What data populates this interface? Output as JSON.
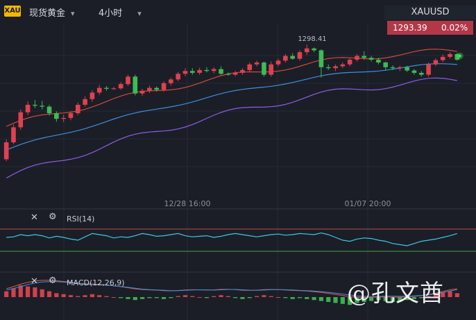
{
  "header": {
    "logo_text": "XAU",
    "symbol_label": "现货黄金",
    "timeframe_label": "4小时",
    "chevron_icon": "chevron-down-icon"
  },
  "quote": {
    "symbol": "XAUUSD",
    "price": "1293.39",
    "change": "0.02%"
  },
  "indicators": {
    "rsi_label": "RSI(14)",
    "macd_label": "MACD(12,26,9)",
    "close_icon": "close-icon",
    "settings_icon": "gear-icon"
  },
  "watermark": "@孔文酋",
  "chart_data": {
    "type": "candlestick",
    "symbol": "XAUUSD",
    "timeframe": "4h",
    "x_tick_labels": [
      "12/28 16:00",
      "01/07 20:00"
    ],
    "price_annotations": {
      "high": "1298.41",
      "last": "1293.39"
    },
    "ohlc": [
      [
        1274.0,
        1278.2,
        1273.6,
        1277.6
      ],
      [
        1277.6,
        1281.4,
        1277.2,
        1280.8
      ],
      [
        1280.8,
        1284.6,
        1280.3,
        1284.0
      ],
      [
        1284.0,
        1286.3,
        1283.4,
        1285.6
      ],
      [
        1285.6,
        1286.6,
        1284.9,
        1285.4
      ],
      [
        1285.4,
        1286.4,
        1284.6,
        1285.2
      ],
      [
        1285.2,
        1285.6,
        1283.3,
        1283.8
      ],
      [
        1283.8,
        1284.2,
        1282.0,
        1282.6
      ],
      [
        1282.6,
        1283.5,
        1281.9,
        1282.8
      ],
      [
        1282.8,
        1284.2,
        1282.3,
        1283.8
      ],
      [
        1283.8,
        1286.1,
        1283.4,
        1285.6
      ],
      [
        1285.6,
        1287.4,
        1285.2,
        1286.8
      ],
      [
        1286.8,
        1288.7,
        1286.2,
        1288.2
      ],
      [
        1288.2,
        1289.8,
        1287.7,
        1289.2
      ],
      [
        1289.2,
        1289.6,
        1288.6,
        1289.0
      ],
      [
        1289.0,
        1289.4,
        1288.8,
        1289.1
      ],
      [
        1289.1,
        1290.4,
        1288.8,
        1290.0
      ],
      [
        1290.0,
        1292.0,
        1289.6,
        1291.6
      ],
      [
        1291.6,
        1292.0,
        1287.6,
        1288.0
      ],
      [
        1288.0,
        1289.0,
        1287.5,
        1288.6
      ],
      [
        1288.6,
        1289.7,
        1288.1,
        1289.2
      ],
      [
        1289.2,
        1289.5,
        1288.4,
        1288.8
      ],
      [
        1288.8,
        1290.6,
        1288.4,
        1290.2
      ],
      [
        1290.2,
        1291.4,
        1289.7,
        1291.0
      ],
      [
        1291.0,
        1292.6,
        1290.6,
        1292.2
      ],
      [
        1292.2,
        1293.4,
        1291.7,
        1292.8
      ],
      [
        1292.8,
        1293.4,
        1292.0,
        1292.4
      ],
      [
        1292.4,
        1293.5,
        1292.0,
        1293.0
      ],
      [
        1293.0,
        1293.6,
        1292.5,
        1292.8
      ],
      [
        1292.8,
        1293.6,
        1292.3,
        1293.2
      ],
      [
        1293.2,
        1293.8,
        1292.0,
        1292.2
      ],
      [
        1292.2,
        1292.5,
        1291.8,
        1292.0
      ],
      [
        1292.0,
        1292.8,
        1291.7,
        1292.4
      ],
      [
        1292.4,
        1293.4,
        1292.0,
        1293.0
      ],
      [
        1293.0,
        1294.6,
        1292.6,
        1294.2
      ],
      [
        1294.2,
        1295.0,
        1293.8,
        1294.6
      ],
      [
        1294.6,
        1294.8,
        1291.6,
        1292.0
      ],
      [
        1292.0,
        1294.8,
        1291.6,
        1294.2
      ],
      [
        1294.2,
        1295.4,
        1293.8,
        1295.0
      ],
      [
        1295.0,
        1296.4,
        1294.6,
        1296.0
      ],
      [
        1296.0,
        1296.6,
        1295.2,
        1295.4
      ],
      [
        1295.4,
        1297.2,
        1295.0,
        1296.8
      ],
      [
        1296.8,
        1298.41,
        1296.2,
        1297.6
      ],
      [
        1297.6,
        1297.8,
        1296.8,
        1297.2
      ],
      [
        1297.2,
        1297.4,
        1291.4,
        1293.6
      ],
      [
        1293.6,
        1294.2,
        1293.0,
        1293.4
      ],
      [
        1293.4,
        1294.2,
        1292.8,
        1293.8
      ],
      [
        1293.8,
        1294.6,
        1293.4,
        1294.2
      ],
      [
        1294.2,
        1295.6,
        1293.8,
        1295.2
      ],
      [
        1295.2,
        1296.4,
        1294.8,
        1296.0
      ],
      [
        1296.0,
        1297.0,
        1295.2,
        1295.6
      ],
      [
        1295.6,
        1296.0,
        1294.8,
        1295.2
      ],
      [
        1295.2,
        1295.6,
        1294.2,
        1294.6
      ],
      [
        1294.6,
        1294.8,
        1293.0,
        1293.6
      ],
      [
        1293.6,
        1294.0,
        1293.0,
        1293.4
      ],
      [
        1293.4,
        1293.9,
        1292.8,
        1293.6
      ],
      [
        1293.6,
        1293.9,
        1292.6,
        1292.9
      ],
      [
        1292.9,
        1293.2,
        1292.0,
        1292.4
      ],
      [
        1292.4,
        1292.8,
        1291.6,
        1292.0
      ],
      [
        1292.0,
        1294.6,
        1291.6,
        1294.2
      ],
      [
        1294.2,
        1295.5,
        1293.8,
        1295.1
      ],
      [
        1295.1,
        1296.3,
        1294.7,
        1295.8
      ],
      [
        1295.8,
        1296.8,
        1295.4,
        1296.4
      ],
      [
        1296.4,
        1296.6,
        1295.0,
        1295.2
      ]
    ],
    "bollinger": {
      "upper_start": 1281.0,
      "upper_end": 1297.0,
      "middle_start": 1276.0,
      "middle_end": 1294.2,
      "lower_start": 1270.0,
      "lower_end": 1290.8
    },
    "rsi": {
      "period": 14,
      "levels": [
        70,
        30
      ],
      "values": [
        55,
        56,
        60,
        58,
        60,
        58,
        54,
        57,
        55,
        52,
        50,
        56,
        62,
        60,
        58,
        54,
        56,
        55,
        58,
        62,
        60,
        57,
        58,
        60,
        62,
        58,
        56,
        57,
        58,
        55,
        57,
        60,
        62,
        60,
        58,
        56,
        58,
        60,
        61,
        59,
        60,
        62,
        61,
        60,
        63,
        60,
        55,
        50,
        48,
        52,
        54,
        53,
        50,
        48,
        44,
        42,
        40,
        44,
        48,
        50,
        52,
        55,
        58,
        62
      ]
    },
    "macd": {
      "fast": 12,
      "slow": 26,
      "signal": 9,
      "histogram": [
        0.6,
        0.9,
        1.2,
        1.1,
        1.0,
        0.8,
        0.6,
        0.4,
        0.3,
        0.2,
        0.1,
        0.2,
        0.3,
        0.2,
        0.1,
        0.0,
        -0.1,
        -0.2,
        -0.3,
        -0.2,
        -0.1,
        -0.1,
        -0.2,
        -0.1,
        0.1,
        0.2,
        0.1,
        0.0,
        -0.1,
        0.1,
        0.2,
        0.1,
        -0.1,
        -0.2,
        -0.1,
        0.1,
        0.2,
        0.1,
        0.0,
        -0.1,
        -0.2,
        -0.1,
        -0.2,
        -0.3,
        -0.4,
        -0.5,
        -0.6,
        -0.7,
        -0.8,
        -0.6,
        -0.5,
        -0.4,
        -0.3,
        -0.4,
        -0.5,
        -0.4,
        -0.3,
        -0.2,
        -0.1,
        0.1,
        0.3,
        0.5,
        0.6,
        0.4
      ]
    },
    "grid": true
  }
}
